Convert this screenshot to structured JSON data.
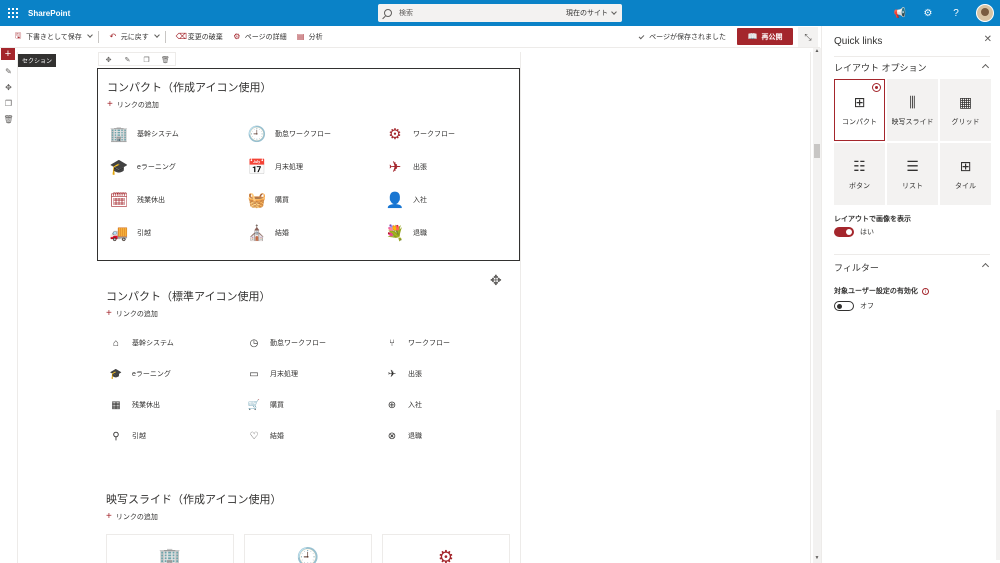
{
  "suitebar": {
    "brand": "SharePoint",
    "search_placeholder": "検索",
    "search_scope": "現在のサイト"
  },
  "commands": {
    "save_draft": "下書きとして保存",
    "undo": "元に戻す",
    "discard": "変更の破棄",
    "page_details": "ページの詳細",
    "analytics": "分析",
    "saved_status": "ページが保存されました",
    "republish": "再公開"
  },
  "section_tag": "セクション",
  "sections": [
    {
      "title": "コンパクト（作成アイコン使用）",
      "add_link": "リンクの追加",
      "links": [
        "基幹システム",
        "勤怠ワークフロー",
        "ワークフロー",
        "eラーニング",
        "月末処理",
        "出張",
        "残業休出",
        "購買",
        "入社",
        "引越",
        "結婚",
        "退職"
      ]
    },
    {
      "title": "コンパクト（標準アイコン使用）",
      "add_link": "リンクの追加",
      "links": [
        "基幹システム",
        "勤怠ワークフロー",
        "ワークフロー",
        "eラーニング",
        "月末処理",
        "出張",
        "残業休出",
        "購買",
        "入社",
        "引越",
        "結婚",
        "退職"
      ]
    },
    {
      "title": "映写スライド（作成アイコン使用）",
      "add_link": "リンクの追加"
    }
  ],
  "panel": {
    "title": "Quick links",
    "layout_options": "レイアウト オプション",
    "layouts": [
      "コンパクト",
      "映写スライド",
      "グリッド",
      "ボタン",
      "リスト",
      "タイル"
    ],
    "show_images_label": "レイアウトで画像を表示",
    "show_images_value": "はい",
    "filter": "フィルター",
    "audience_label": "対象ユーザー設定の有効化",
    "audience_value": "オフ"
  },
  "colors": {
    "suitebar": "#0a82c7",
    "accent": "#a4262c"
  }
}
